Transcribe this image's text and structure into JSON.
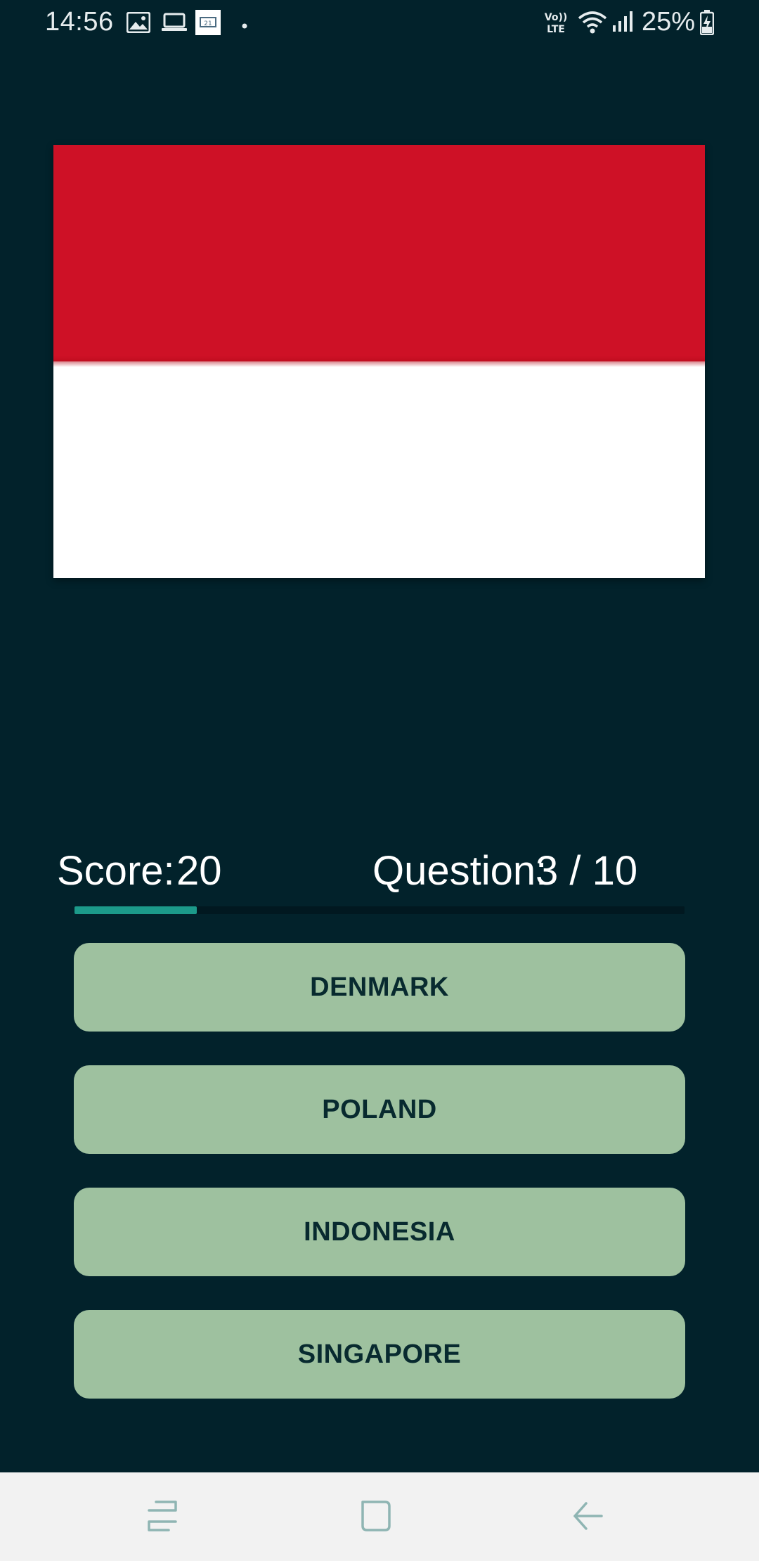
{
  "status_bar": {
    "time": "14:56",
    "battery": "25%",
    "icons": [
      "image-icon",
      "laptop-icon",
      "notification-app-icon",
      "dot-icon",
      "volte-icon",
      "wifi-icon",
      "signal-icon",
      "battery-charging-icon"
    ]
  },
  "flag": {
    "country_colors": [
      "#ce1126",
      "#ffffff"
    ]
  },
  "score": {
    "label": "Score:",
    "value": "20"
  },
  "question": {
    "label": "Question:",
    "value": "3 / 10"
  },
  "progress": {
    "fraction": 0.2
  },
  "answers": [
    {
      "label": "DENMARK"
    },
    {
      "label": "POLAND"
    },
    {
      "label": "INDONESIA"
    },
    {
      "label": "SINGAPORE"
    }
  ],
  "nav_bar": {
    "buttons": [
      "recents-icon",
      "home-icon",
      "back-icon"
    ]
  },
  "colors": {
    "background": "#02222b",
    "button": "#9ec19f",
    "button_text": "#082a2f",
    "progress": "#1c9a8a"
  }
}
